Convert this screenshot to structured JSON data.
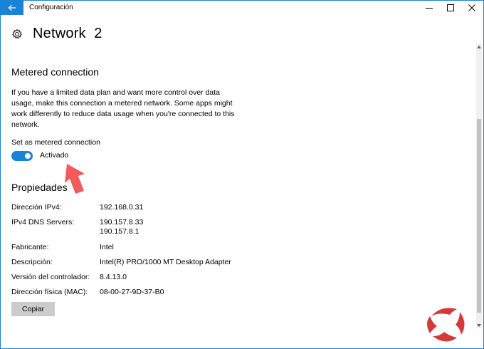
{
  "window": {
    "title": "Configuración"
  },
  "page": {
    "title": "Network  2"
  },
  "metered": {
    "section_title": "Metered connection",
    "description": "If you have a limited data plan and want more control over data usage, make this connection a metered network. Some apps might work differently to reduce data usage when you're connected to this network.",
    "toggle_label": "Set as metered connection",
    "toggle_state": "Activado",
    "toggle_on": true
  },
  "properties": {
    "section_title": "Propiedades",
    "ipv4_label": "Dirección IPv4:",
    "ipv4_value": "192.168.0.31",
    "dns_label": "IPv4 DNS Servers:",
    "dns_value_1": "190.157.8.33",
    "dns_value_2": "190.157.8.1",
    "manufacturer_label": "Fabricante:",
    "manufacturer_value": "Intel",
    "description_label": "Descripción:",
    "description_value": "Intel(R) PRO/1000 MT Desktop Adapter",
    "driver_label": "Versión del controlador:",
    "driver_value": "8.4.13.0",
    "mac_label": "Dirección física (MAC):",
    "mac_value": "08-00-27-9D-37-B0",
    "copy_label": "Copiar"
  },
  "colors": {
    "accent": "#1883d7",
    "arrow": "#f25b5b",
    "logo_red": "#d33a3a"
  },
  "icons": {
    "back": "back-arrow-icon",
    "minimize": "minimize-icon",
    "maximize": "maximize-icon",
    "close": "close-icon",
    "settings": "gear-icon",
    "annotation": "pointer-arrow-icon",
    "brand": "site-logo-icon"
  }
}
